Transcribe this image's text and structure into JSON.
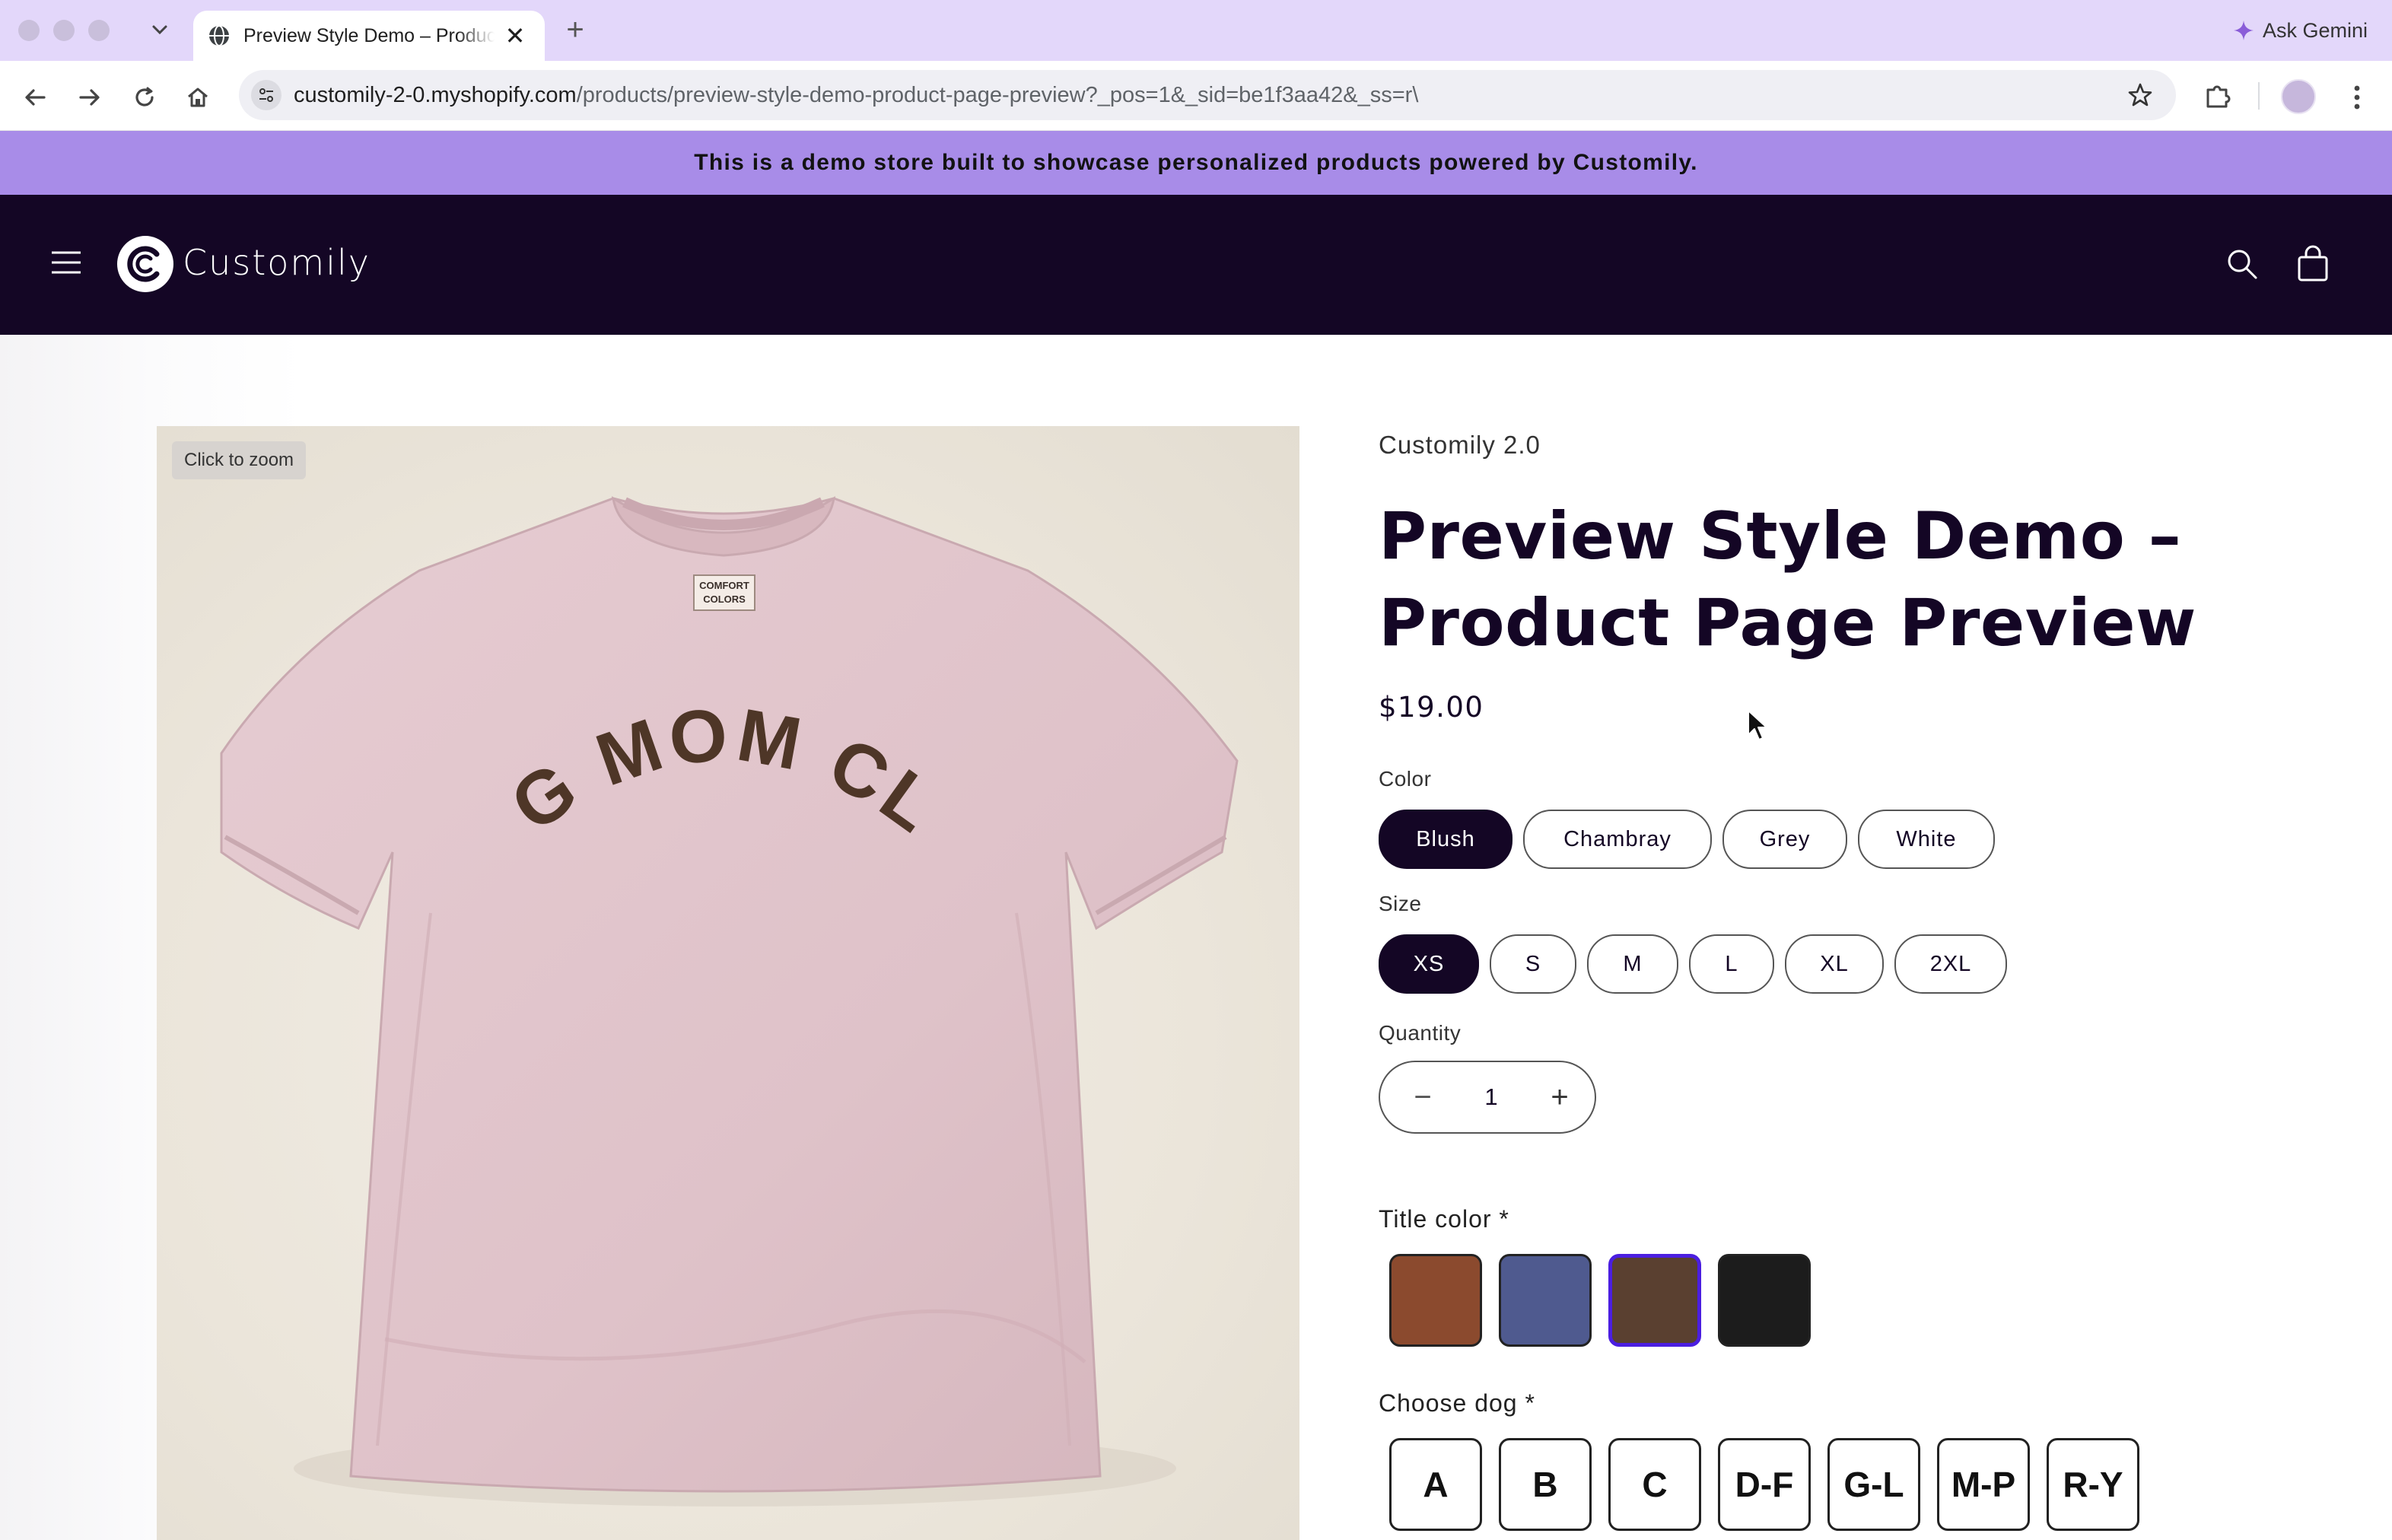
{
  "browser": {
    "tab_title": "Preview Style Demo – Product Page Preview",
    "new_tab_symbol": "+",
    "close_symbol": "✕",
    "ask_gemini": "Ask Gemini",
    "url_host": "customily-2-0.myshopify.com",
    "url_path": "/products/preview-style-demo-product-page-preview?_pos=1&_sid=be1f3aa42&_ss=r\\"
  },
  "announcement": "This is a demo store built to showcase personalized products powered by Customily.",
  "header": {
    "brand": "Customily",
    "icons": [
      "menu-icon",
      "search-icon",
      "cart-icon"
    ]
  },
  "media": {
    "zoom_hint": "Click to zoom",
    "shirt_text": "DOG MOM CLUB",
    "shirt_label": [
      "COMFORT",
      "COLORS"
    ],
    "shirt_color": "#e0c4cb",
    "print_color": "#4e3627"
  },
  "product": {
    "vendor": "Customily 2.0",
    "title_line1": "Preview Style Demo –",
    "title_line2": "Product Page Preview",
    "price": "$19.00",
    "color": {
      "label": "Color",
      "options": [
        "Blush",
        "Chambray",
        "Grey",
        "White"
      ],
      "selected": "Blush"
    },
    "size": {
      "label": "Size",
      "options": [
        "XS",
        "S",
        "M",
        "L",
        "XL",
        "2XL"
      ],
      "selected": "XS"
    },
    "quantity": {
      "label": "Quantity",
      "minus": "−",
      "value": "1",
      "plus": "+"
    },
    "title_color": {
      "label": "Title color *",
      "swatches": [
        "#8b4a2e",
        "#4f5a8f",
        "#5a4030",
        "#1c1c1c"
      ],
      "selected_index": 2
    },
    "choose_dog": {
      "label": "Choose dog *",
      "options": [
        "A",
        "B",
        "C",
        "D-F",
        "G-L",
        "M-P",
        "R-Y"
      ]
    }
  },
  "colors": {
    "accent": "#a88ce8",
    "header_bg": "#140625",
    "selected_outline": "#4b1ee0"
  }
}
